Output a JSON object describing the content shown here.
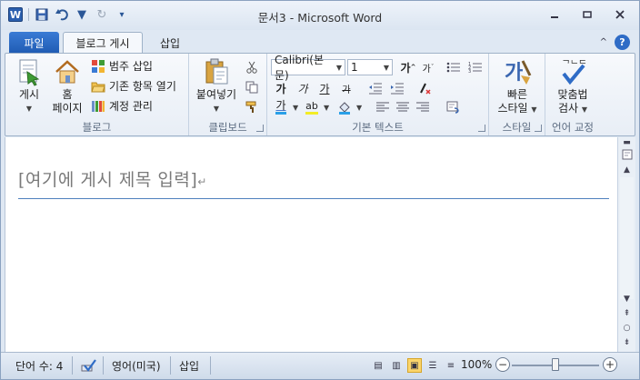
{
  "window": {
    "title": "문서3  -  Microsoft Word",
    "qat_icons": [
      "word-logo",
      "save-icon",
      "undo-icon",
      "redo-icon",
      "customize-icon"
    ]
  },
  "tabs": {
    "file": "파일",
    "items": [
      {
        "label": "블로그 게시",
        "active": true
      },
      {
        "label": "삽입",
        "active": false
      }
    ]
  },
  "ribbon": {
    "blog": {
      "label": "블로그",
      "publish": "게시",
      "home_line1": "홈",
      "home_line2": "페이지",
      "insert_category": "범주 삽입",
      "open_existing": "기존 항목 열기",
      "manage_accounts": "계정 관리"
    },
    "clipboard": {
      "label": "클립보드",
      "paste": "붙여넣기"
    },
    "basic_text": {
      "label": "기본 텍스트",
      "font_name": "Calibri(본문)",
      "font_size": "1",
      "grow_font": "가",
      "shrink_font": "가",
      "bold": "가",
      "italic": "가",
      "underline": "가",
      "strike": "가"
    },
    "styles": {
      "label": "스타일",
      "quick_styles_line1": "빠른",
      "quick_styles_line2": "스타일"
    },
    "proofing": {
      "label": "언어 교정",
      "spelling_line1": "맞춤법",
      "spelling_line2": "검사"
    }
  },
  "document": {
    "title_placeholder": "[여기에 게시 제목 입력]"
  },
  "statusbar": {
    "word_count": "단어 수: 4",
    "language": "영어(미국)",
    "insert_mode": "삽입",
    "zoom": "100%",
    "zoom_level": 1.0
  },
  "colors": {
    "accent": "#2b5fae",
    "file_tab": "#1f5bb3",
    "title_rule": "#4f81bd"
  }
}
